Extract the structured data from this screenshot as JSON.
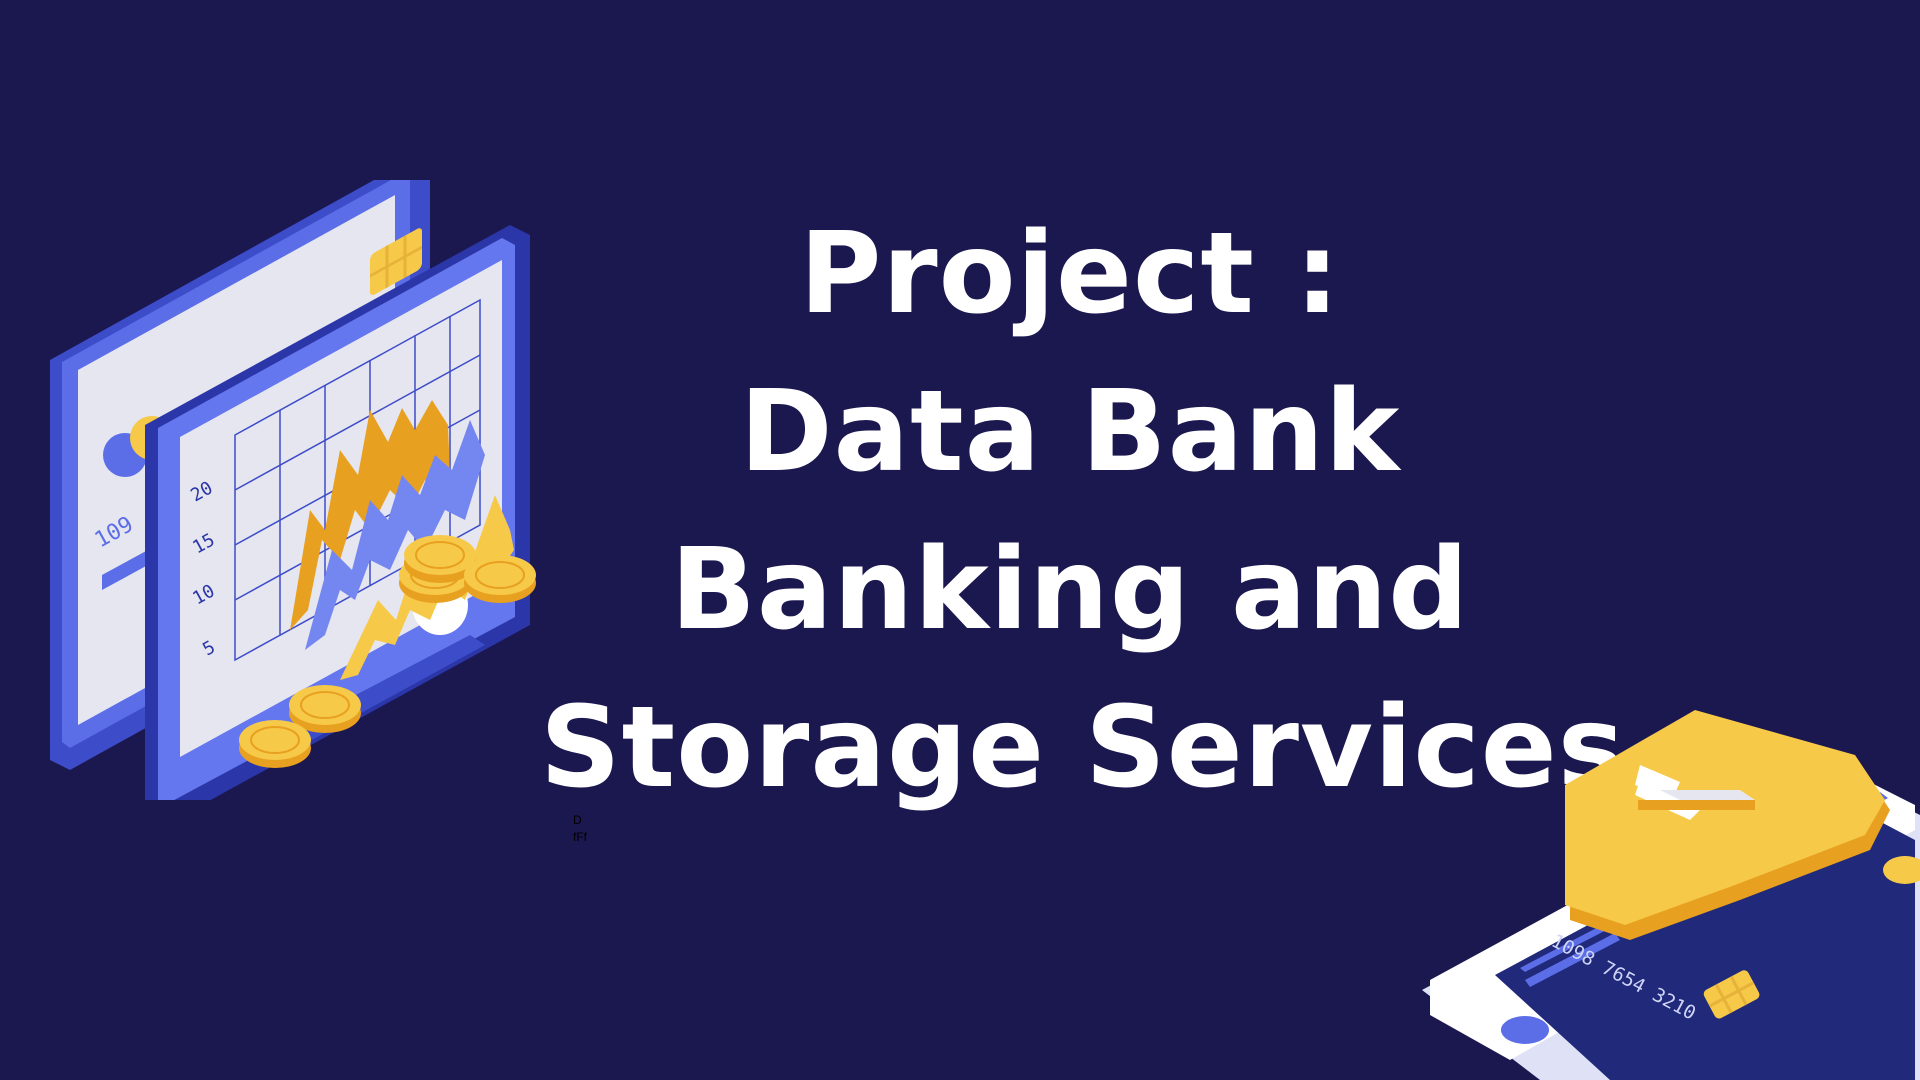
{
  "title": {
    "lines": [
      "Project :",
      "Data Bank",
      "Banking and",
      "Storage Services"
    ]
  },
  "note": {
    "line1": "D",
    "line2": "fFf"
  },
  "left_illustration": {
    "card_number_fragment": "109",
    "chart_tick_labels": [
      "20",
      "15",
      "10",
      "5"
    ],
    "coin_symbol": "¥"
  },
  "right_illustration": {
    "card_number": "1098 7654 3210"
  },
  "colors": {
    "background": "#1b174f",
    "accent_blue": "#5b6ee8",
    "accent_yellow": "#f7c948",
    "accent_orange": "#e8a020",
    "text": "#ffffff"
  },
  "icons": [
    "monitor-chart-illustration",
    "coins-icon",
    "shield-check-icon",
    "phone-card-illustration"
  ]
}
